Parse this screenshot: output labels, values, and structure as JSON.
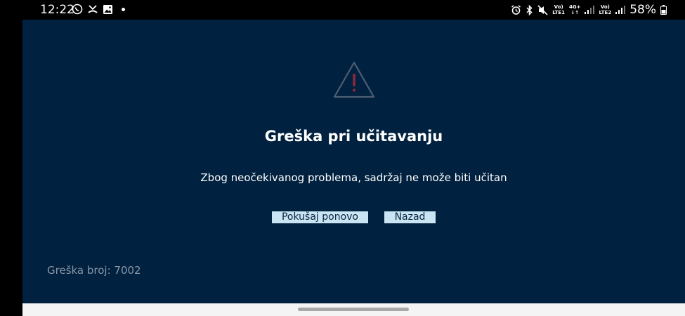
{
  "status_bar": {
    "time": "12:22",
    "left_icons": [
      "viber-icon",
      "missed-call-icon",
      "gallery-icon",
      "notification-dot-icon"
    ],
    "right_icons": [
      "alarm-icon",
      "bluetooth-icon",
      "mute-icon"
    ],
    "sim1_label_top": "Vo)",
    "sim1_label_bottom": "LTE1",
    "net_label_top": "4G+",
    "sim2_label_top": "Vo)",
    "sim2_label_bottom": "LTE2",
    "battery_percent": "58%"
  },
  "error_screen": {
    "icon": "warning-icon",
    "title": "Greška pri učitavanju",
    "message": "Zbog neočekivanog problema, sadržaj ne može biti učitan",
    "retry_label": "Pokušaj ponovo",
    "back_label": "Nazad",
    "error_code": "Greška broj: 7002"
  },
  "colors": {
    "panel_background": "#00213f",
    "button_background": "#c9e4f2",
    "warning_outline": "#4d5e72",
    "warning_mark": "#8b2a3a",
    "error_code_text": "#8a96a6"
  }
}
